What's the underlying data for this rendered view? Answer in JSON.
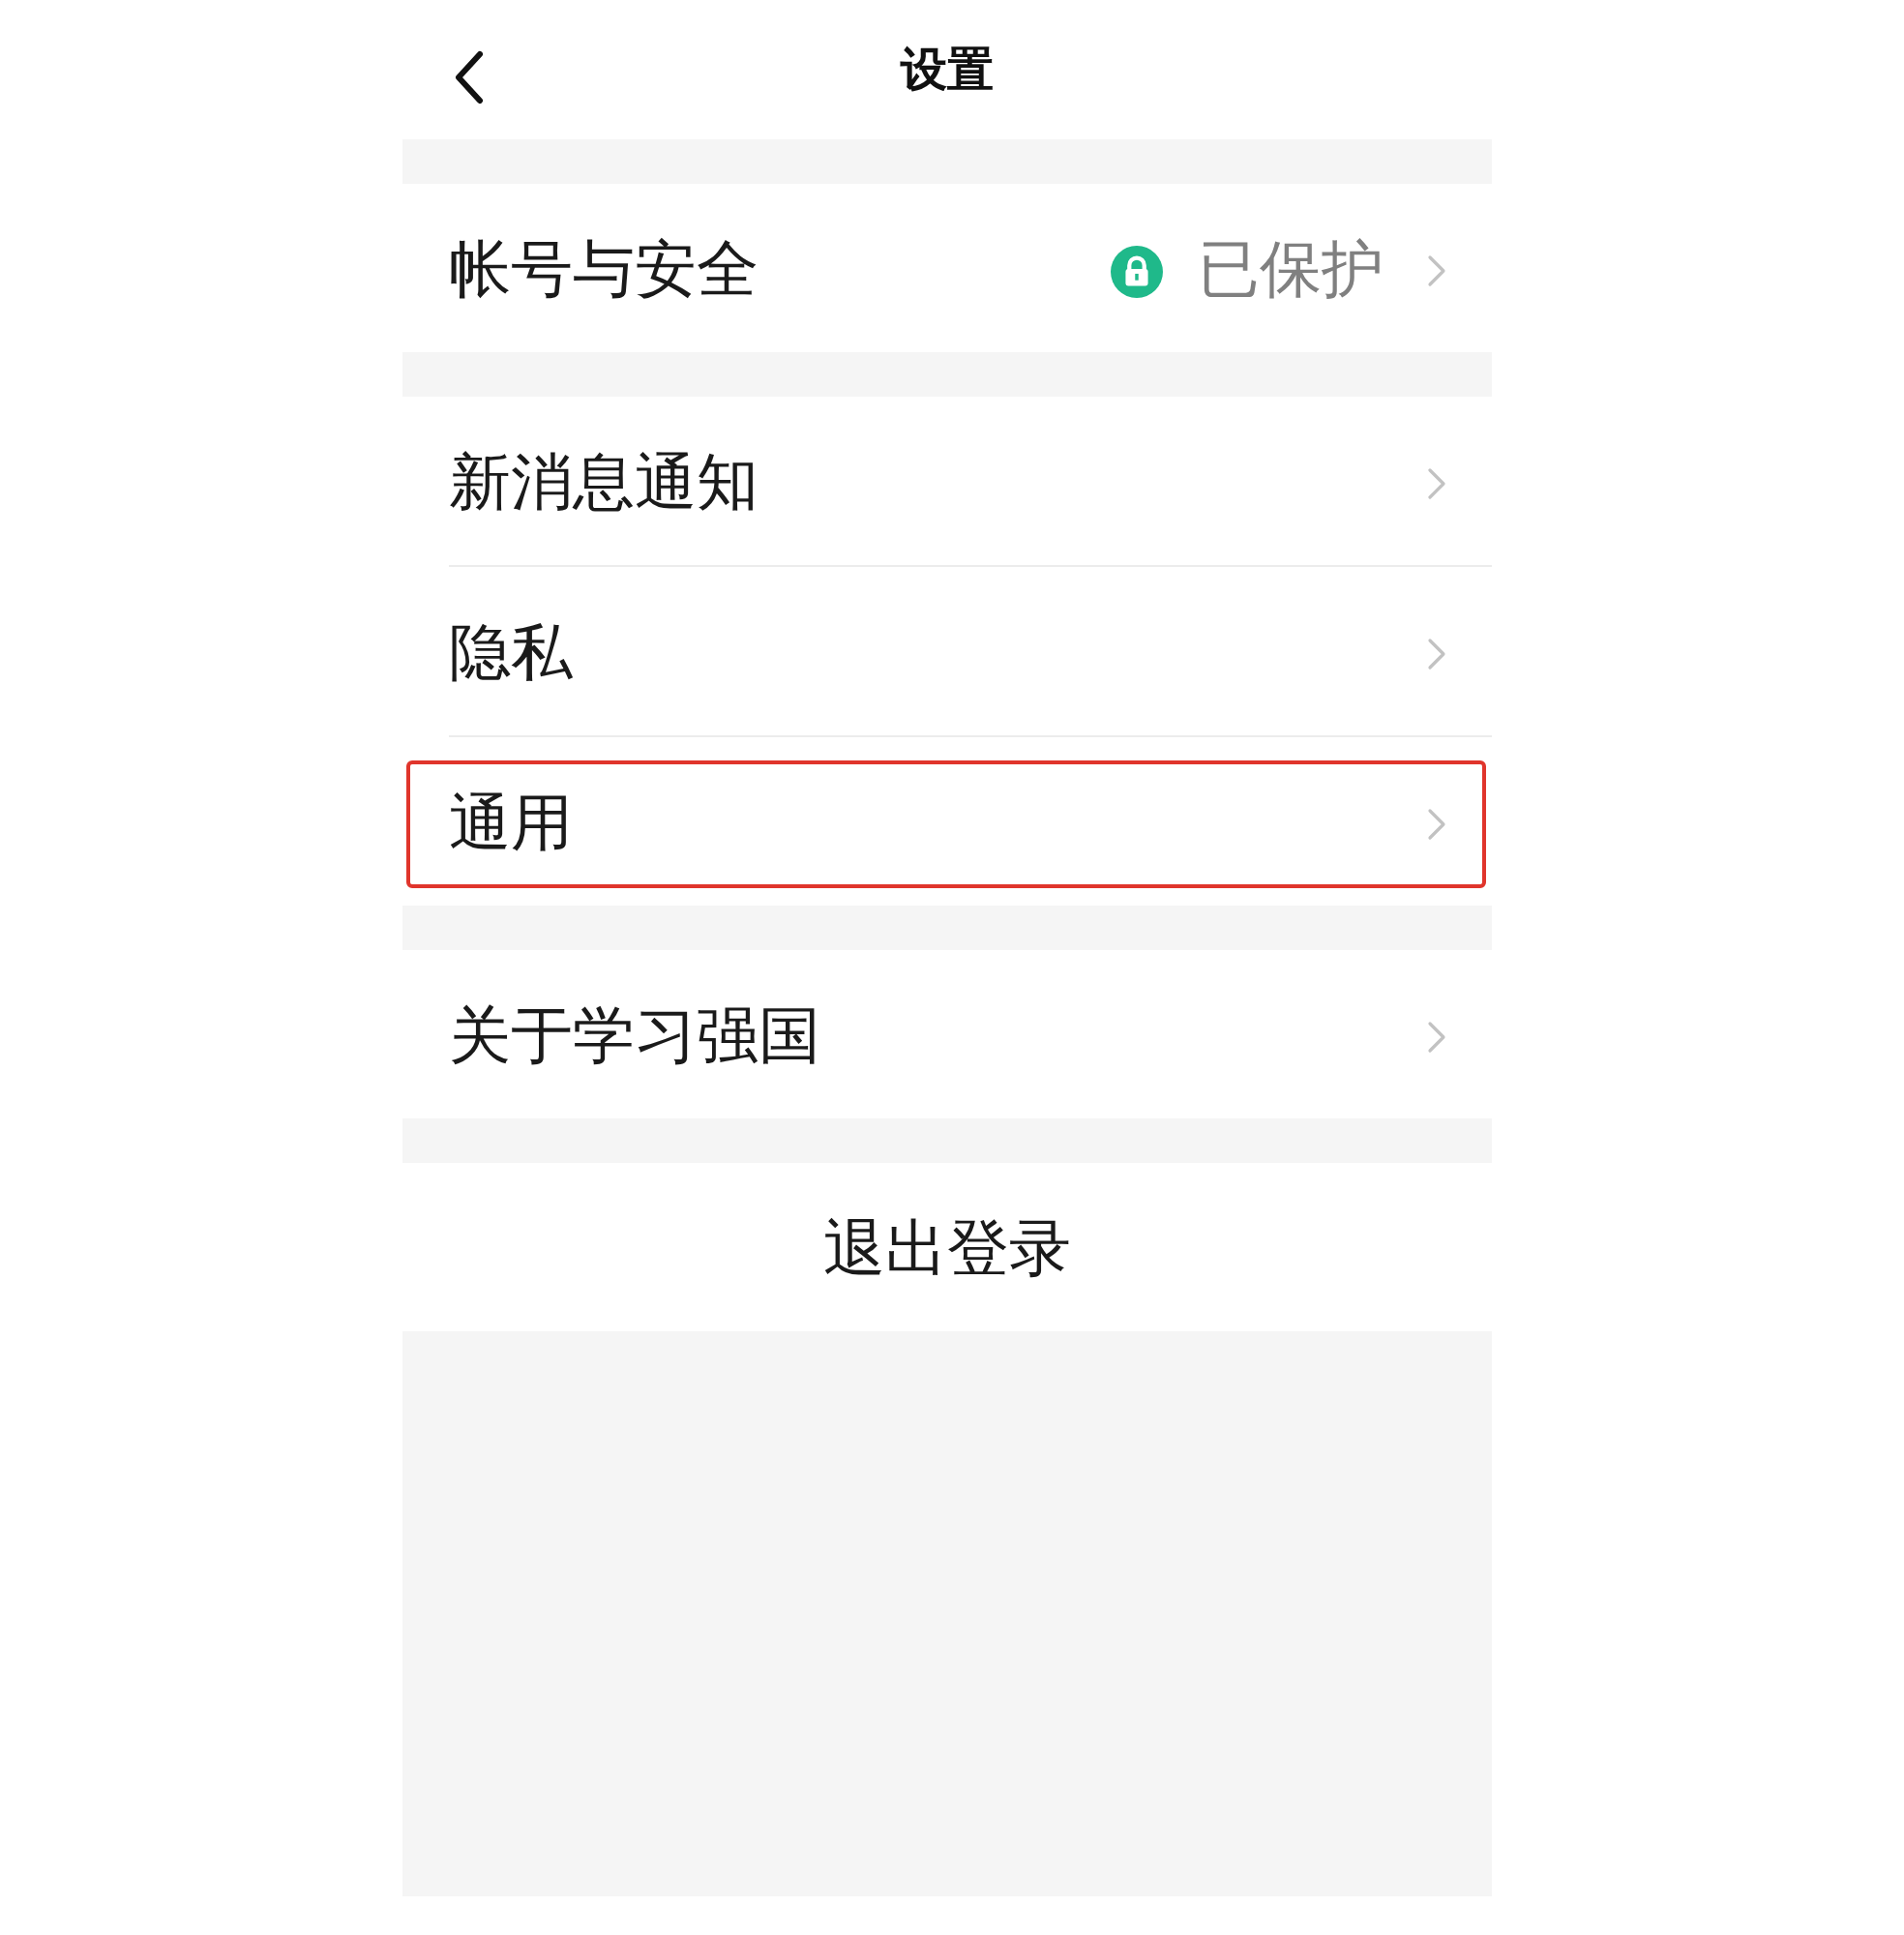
{
  "header": {
    "title": "设置"
  },
  "groups": [
    {
      "items": [
        {
          "label": "帐号与安全",
          "status": "已保护",
          "highlighted": false
        }
      ]
    },
    {
      "items": [
        {
          "label": "新消息通知",
          "highlighted": false
        },
        {
          "label": "隐私",
          "highlighted": false
        },
        {
          "label": "通用",
          "highlighted": true
        }
      ]
    },
    {
      "items": [
        {
          "label": "关于学习强国",
          "highlighted": false
        }
      ]
    }
  ],
  "logout_button": {
    "label": "退出登录"
  }
}
